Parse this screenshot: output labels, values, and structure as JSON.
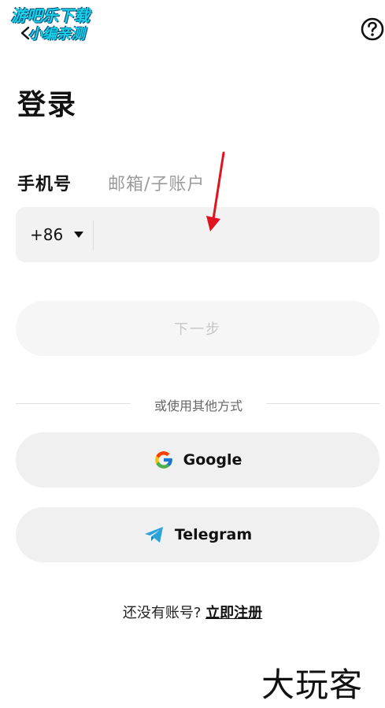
{
  "watermark_top": {
    "line1": "游吧乐下载",
    "line2": "小编亲测"
  },
  "watermark_bottom": "大玩客",
  "header": {
    "title": "登录"
  },
  "tabs": {
    "phone": "手机号",
    "email": "邮箱/子账户"
  },
  "phone_form": {
    "country_code": "+86",
    "input_value": ""
  },
  "next_button": "下一步",
  "divider_text": "或使用其他方式",
  "social": {
    "google": "Google",
    "telegram": "Telegram"
  },
  "signup": {
    "prompt": "还没有账号?",
    "link": "立即注册"
  },
  "colors": {
    "field_bg": "#f2f2f2",
    "button_bg": "#f0f0f0",
    "disabled_text": "#c6c6c6",
    "muted_text": "#9b9b9b",
    "telegram_blue": "#2aa3dd",
    "annotation_red": "#e0141e"
  },
  "icons": {
    "back": "chevron-left-icon",
    "help": "question-circle-icon",
    "country_caret": "caret-down-icon",
    "google": "google-logo-icon",
    "telegram": "telegram-plane-icon"
  }
}
